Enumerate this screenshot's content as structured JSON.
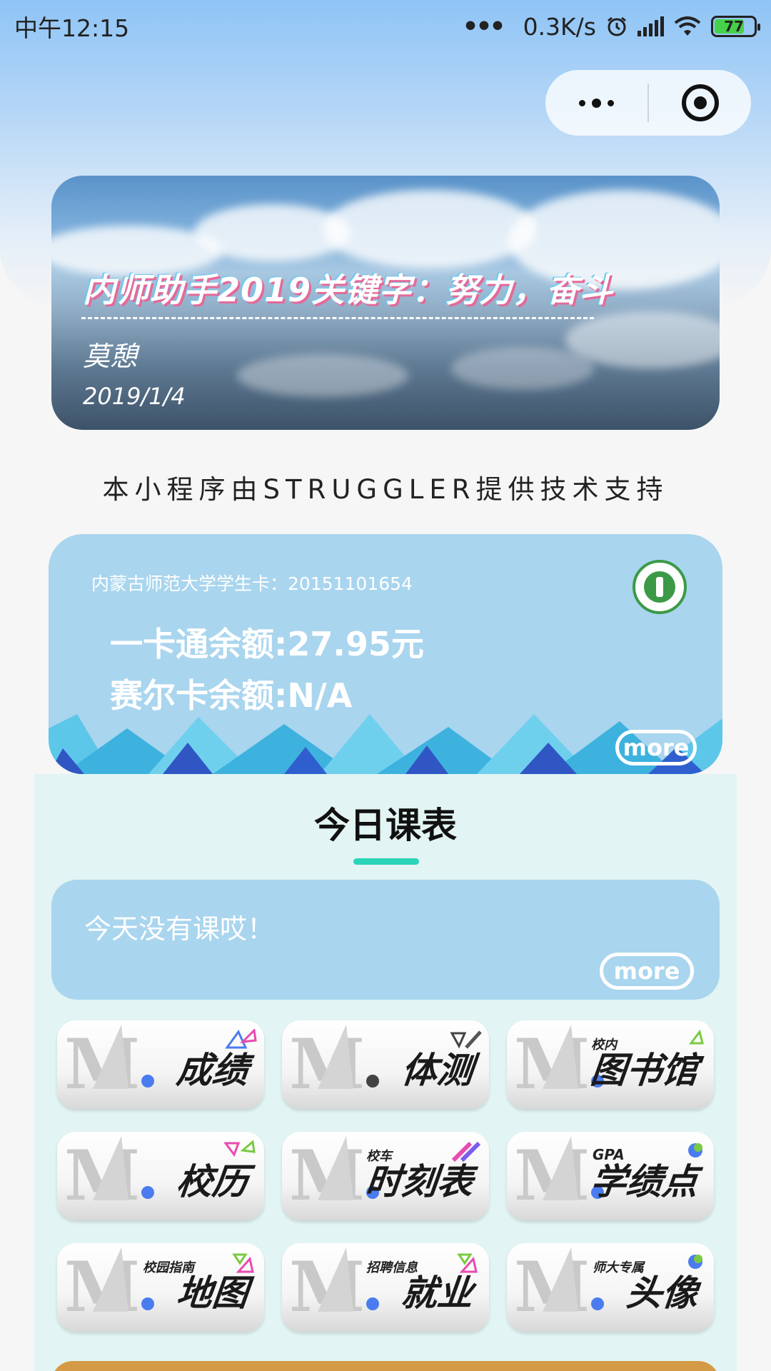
{
  "status_bar": {
    "time": "中午12:15",
    "dots": "•••",
    "speed": "0.3K/s",
    "alarm_icon": "alarm-icon",
    "battery_level": "77",
    "battery_fill_fraction": 0.77
  },
  "capsule": {
    "more_icon": "more-dots-icon",
    "close_icon": "close-circle-icon"
  },
  "banner": {
    "title": "内师助手2019关键字：努力，奋斗",
    "author": "莫憩",
    "date": "2019/1/4"
  },
  "credit": "本小程序由STRUGGLER提供技术支持",
  "card": {
    "id_label": "内蒙古师范大学学生卡：20151101654",
    "balance": "一卡通余额:27.95元",
    "saier_balance": "赛尔卡余额:N/A",
    "more_label": "more"
  },
  "schedule": {
    "title": "今日课表",
    "empty_text": "今天没有课哎！",
    "more_label": "more"
  },
  "grid": [
    {
      "label": "成绩",
      "sub": ""
    },
    {
      "label": "体测",
      "sub": ""
    },
    {
      "label": "图书馆",
      "sub": "校内"
    },
    {
      "label": "校历",
      "sub": ""
    },
    {
      "label": "时刻表",
      "sub": "校车"
    },
    {
      "label": "学绩点",
      "sub": "GPA"
    },
    {
      "label": "地图",
      "sub": "校园指南"
    },
    {
      "label": "就业",
      "sub": "招聘信息"
    },
    {
      "label": "头像",
      "sub": "师大专属"
    }
  ],
  "colors": {
    "accent": "#2bd3b9",
    "card_bg": "#a9d5ee",
    "section_bg": "#e2f4f3"
  }
}
